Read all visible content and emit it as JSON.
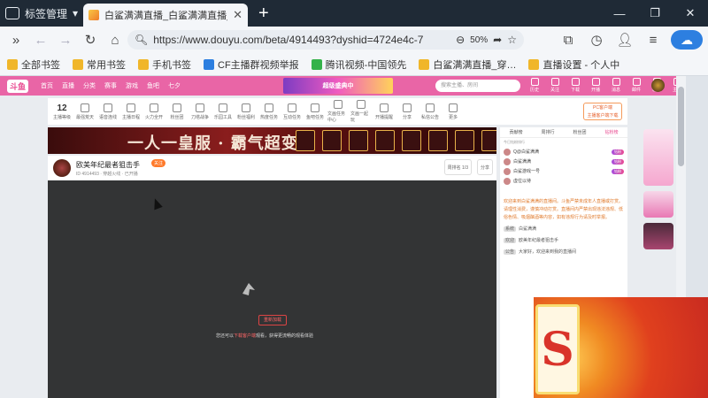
{
  "browser": {
    "tab_group_label": "标签管理",
    "tab_title": "白鲨满满直播_白鲨满满直播_白",
    "url": "https://www.douyu.com/beta/4914493?dyshid=4724e4c-7",
    "zoom": "50%",
    "bookmarks": [
      {
        "label": "全部书签",
        "color": "#f0b62a"
      },
      {
        "label": "常用书签",
        "color": "#f0b62a"
      },
      {
        "label": "手机书签",
        "color": "#f0b62a"
      },
      {
        "label": "CF主播群视频举报",
        "color": "#2d7fe0"
      },
      {
        "label": "腾讯视频-中国领先",
        "color": "#35b24a"
      },
      {
        "label": "白鲨满满直播_穿…",
        "color": "#f0b62a"
      },
      {
        "label": "直播设置 - 个人中",
        "color": "#f0b62a"
      }
    ]
  },
  "douyu": {
    "logo": "斗鱼",
    "nav": [
      "首页",
      "直播",
      "分类",
      "赛事",
      "游戏",
      "鱼吧",
      "七夕"
    ],
    "banner": "超级盛典中",
    "search_placeholder": "搜索主播、房间",
    "top_icons": [
      "历史",
      "关注",
      "下载",
      "开播",
      "消息",
      "邮件",
      "粉丝",
      "主页"
    ],
    "toolbar": {
      "level_num": "12",
      "items": [
        "主播等级",
        "最强荒天",
        "语音连线",
        "主播日程",
        "火力全开",
        "粉丝团",
        "刀塔战争",
        "乐园工具",
        "粉丝福利",
        "热度任务",
        "互动任务",
        "鱼吧任务",
        "文画任务中心",
        "文画一起玩",
        "开播提醒",
        "分享",
        "私信公告",
        "更多"
      ],
      "pc_button": "PC客户端",
      "pc_sub": "主播客户端下载"
    },
    "event_banner": "一人一皇服 · 霸气超变版",
    "room": {
      "title": "欧美年纪最者狙击手",
      "meta": "ID 4914493 · 穿越火线 · 已开播",
      "follow": "关注",
      "rank_label": "周排名 1/3",
      "share": "分享"
    },
    "player": {
      "retry": "重新加载",
      "message_prefix": "您还可以",
      "message_link": "下载客户端",
      "message_suffix": "观看，获得更流畅的观看体验"
    },
    "chat": {
      "tabs": [
        "贡献榜",
        "周排行",
        "粉丝团",
        "钻粉榜"
      ],
      "active_tab": "钻粉榜",
      "subline": "今日钻粉排行",
      "ranks": [
        {
          "name": "Q@白鲨满满",
          "badge": "钻粉"
        },
        {
          "name": "白鲨满满",
          "badge": "钻粉"
        },
        {
          "name": "白鲨游戏一号",
          "badge": "钻粉"
        },
        {
          "name": "虚位以待",
          "badge": ""
        }
      ],
      "notice": "欢迎来到白鲨满满的直播间。斗鱼严禁未成年人直播或打赏。请理性消费，谨慎冲动打赏。直播间内严禁出现违法违规、低俗色情、吸烟酗酒等内容，如有违规行为请及时举报。",
      "sys_messages": [
        {
          "tag": "系统",
          "text": "白鲨满满"
        },
        {
          "tag": "欢迎",
          "text": "欧美年纪最者狙击手"
        },
        {
          "tag": "公告",
          "text": "大家好，欢迎来到我的直播间"
        }
      ]
    }
  }
}
